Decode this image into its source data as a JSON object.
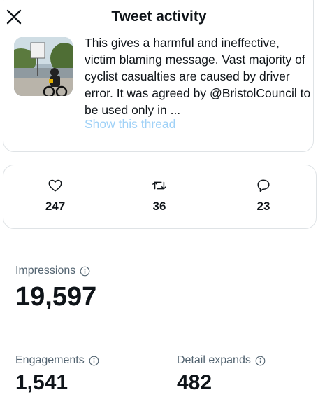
{
  "header": {
    "title": "Tweet activity",
    "close_icon": "close-icon"
  },
  "tweet": {
    "text": "This gives a harmful and ineffective, victim blaming message. Vast majority of cyclist casualties are caused by driver error. It was agreed by @BristolCouncil to be used only in ...",
    "show_thread": "Show this thread"
  },
  "stats": {
    "likes": {
      "icon": "heart-icon",
      "value": "247"
    },
    "retweets": {
      "icon": "retweet-icon",
      "value": "36"
    },
    "replies": {
      "icon": "reply-icon",
      "value": "23"
    }
  },
  "metrics": {
    "impressions": {
      "label": "Impressions",
      "value": "19,597"
    },
    "engagements": {
      "label": "Engagements",
      "value": "1,541"
    },
    "detail_expands": {
      "label": "Detail expands",
      "value": "482"
    }
  },
  "colors": {
    "text": "#0f1419",
    "secondary": "#536471",
    "link_faded": "#9fd1f7",
    "border": "#dfe3e6"
  }
}
